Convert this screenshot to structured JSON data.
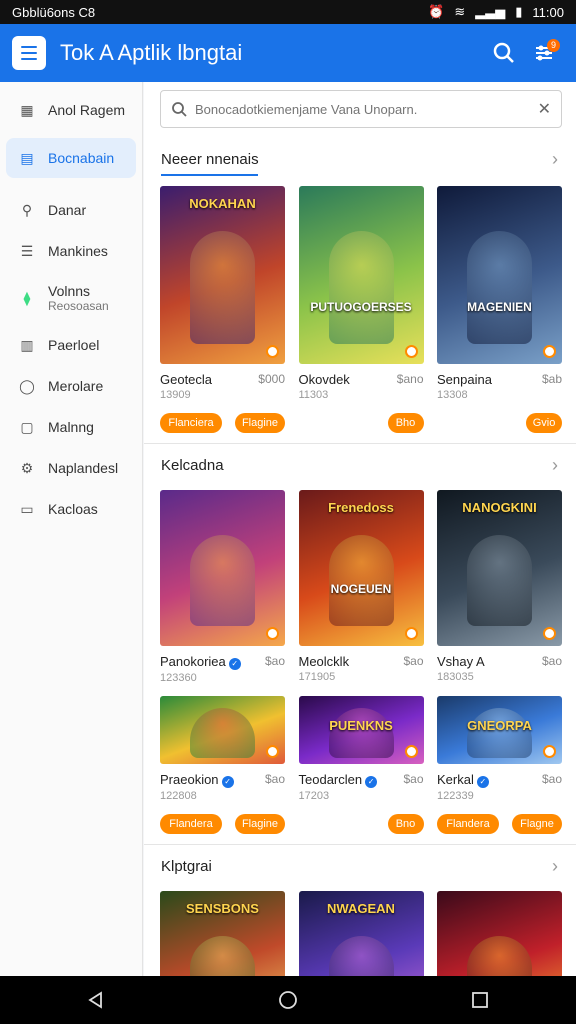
{
  "status": {
    "left": "Gbblü6ons C8",
    "time": "11:00"
  },
  "appbar": {
    "title": "Tok A Aptlik lbngtai",
    "badge": "9"
  },
  "sidebar": {
    "items": [
      {
        "label": "Anol Ragem",
        "icon": "apps-icon"
      },
      {
        "label": "Bocnabain",
        "icon": "calendar-icon",
        "active": true
      },
      {
        "label": "Danar",
        "icon": "search-icon"
      },
      {
        "label": "Mankines",
        "icon": "list-icon"
      },
      {
        "label": "Volnns",
        "sub": "Reosoasan",
        "icon": "android-icon"
      },
      {
        "label": "Paerloel",
        "icon": "grid-icon"
      },
      {
        "label": "Merolare",
        "icon": "person-icon"
      },
      {
        "label": "Malnng",
        "icon": "square-icon"
      },
      {
        "label": "Naplandesl",
        "icon": "gear-icon"
      },
      {
        "label": "Kacloas",
        "icon": "message-icon"
      }
    ]
  },
  "search": {
    "placeholder": "Bonocadotkiemenjame Vana Unoparn."
  },
  "sections": [
    {
      "title": "Neeer nnenais",
      "cards": [
        {
          "art_title": "NOKAHAN",
          "art_bottom": "",
          "name": "Geotecla",
          "price": "$000",
          "sub": "13909",
          "colors": [
            "#3a1d6e",
            "#c0452a",
            "#f0a040"
          ]
        },
        {
          "art_title": "",
          "art_bottom": "PUTUOGOERSES",
          "name": "Okovdek",
          "price": "$ano",
          "sub": "11303",
          "colors": [
            "#2b7a5a",
            "#8bc34a",
            "#e8e05a"
          ]
        },
        {
          "art_title": "",
          "art_bottom": "MAGENIEN",
          "name": "Senpaina",
          "price": "$ab",
          "sub": "13308",
          "colors": [
            "#0f1a3a",
            "#3d5a8a",
            "#7aa0c8"
          ]
        }
      ],
      "buttons": [
        [
          "Flanciera",
          "Flagine"
        ],
        [
          null,
          "Bho"
        ],
        [
          null,
          "Gvio"
        ]
      ]
    },
    {
      "title": "Kelcadna",
      "cards": [
        {
          "art_title": "",
          "art_bottom": "",
          "name": "Panokoriea",
          "price": "$ao",
          "sub": "123360",
          "colors": [
            "#5a2a8a",
            "#c2417a",
            "#f5a84a"
          ],
          "verified": true
        },
        {
          "art_title": "Frenedoss",
          "art_bottom": "NOGEUEN",
          "name": "Meolcklk",
          "price": "$ao",
          "sub": "171905",
          "colors": [
            "#6a1a1a",
            "#d84a1a",
            "#f8c040"
          ]
        },
        {
          "art_title": "NANOGKINI",
          "art_bottom": "",
          "name": "Vshay A",
          "price": "$ao",
          "sub": "183035",
          "colors": [
            "#101820",
            "#3a4a5a",
            "#8a9aa8"
          ]
        }
      ],
      "cards2": [
        {
          "name": "Praeokion",
          "price": "$ao",
          "sub": "122808",
          "colors": [
            "#2a8a3a",
            "#f0c030",
            "#e05a3a"
          ],
          "verified": true
        },
        {
          "name": "Teodarclen",
          "price": "$ao",
          "sub": "17203",
          "colors": [
            "#2a0a4a",
            "#7a2ac8",
            "#d860c0"
          ],
          "verified": true,
          "art_title": "PUENKNS"
        },
        {
          "name": "Kerkal",
          "price": "$ao",
          "sub": "122339",
          "colors": [
            "#1a3a6a",
            "#3a7ad8",
            "#a0c8f0"
          ],
          "verified": true,
          "art_title": "GNEORPA"
        }
      ],
      "buttons": [
        [
          "Flandera",
          "Flagine"
        ],
        [
          null,
          "Bno"
        ],
        [
          "Flandera",
          "Flagne"
        ]
      ]
    },
    {
      "title": "Klptgrai",
      "cards": [
        {
          "art_title": "SENSBONS",
          "colors": [
            "#2a4a1a",
            "#c04a2a",
            "#f0c060"
          ]
        },
        {
          "art_title": "NWAGEAN",
          "colors": [
            "#1a1a4a",
            "#5a3ab8",
            "#c06ad8"
          ]
        },
        {
          "art_title": "",
          "colors": [
            "#3a0a1a",
            "#c0202a",
            "#f8a030"
          ]
        }
      ]
    }
  ]
}
